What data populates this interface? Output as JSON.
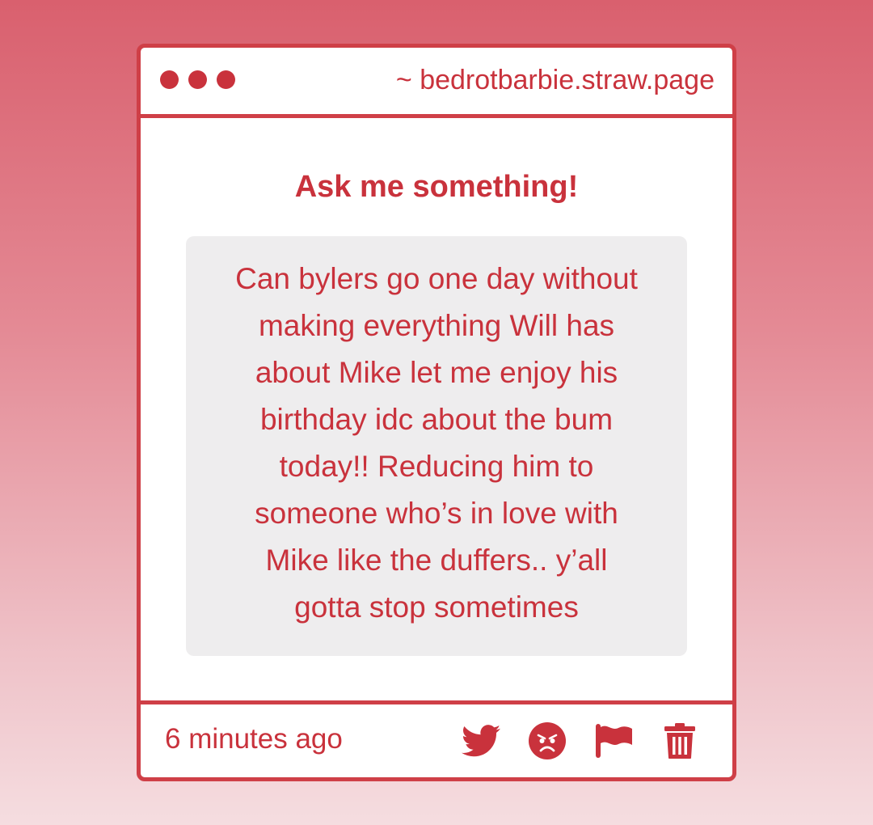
{
  "window": {
    "url_label": "~ bedrotbarbie.straw.page",
    "dots": [
      "dot",
      "dot",
      "dot"
    ]
  },
  "main": {
    "title": "Ask me something!",
    "question_lines": [
      "Can bylers go one day without",
      "making everything Will has",
      "about Mike let me enjoy his",
      "birthday idc about the bum",
      "today!! Reducing him to",
      "someone who’s in love with",
      "Mike like the duffers.. y’all",
      "gotta stop sometimes"
    ]
  },
  "footer": {
    "timestamp": "6 minutes ago",
    "actions": [
      {
        "icon": "twitter-bird-icon"
      },
      {
        "icon": "angry-face-icon"
      },
      {
        "icon": "flag-icon"
      },
      {
        "icon": "trash-icon"
      }
    ]
  },
  "colors": {
    "accent": "#c9323c",
    "border": "#cf3f47",
    "bubble": "#eeedee",
    "card": "#ffffff"
  }
}
